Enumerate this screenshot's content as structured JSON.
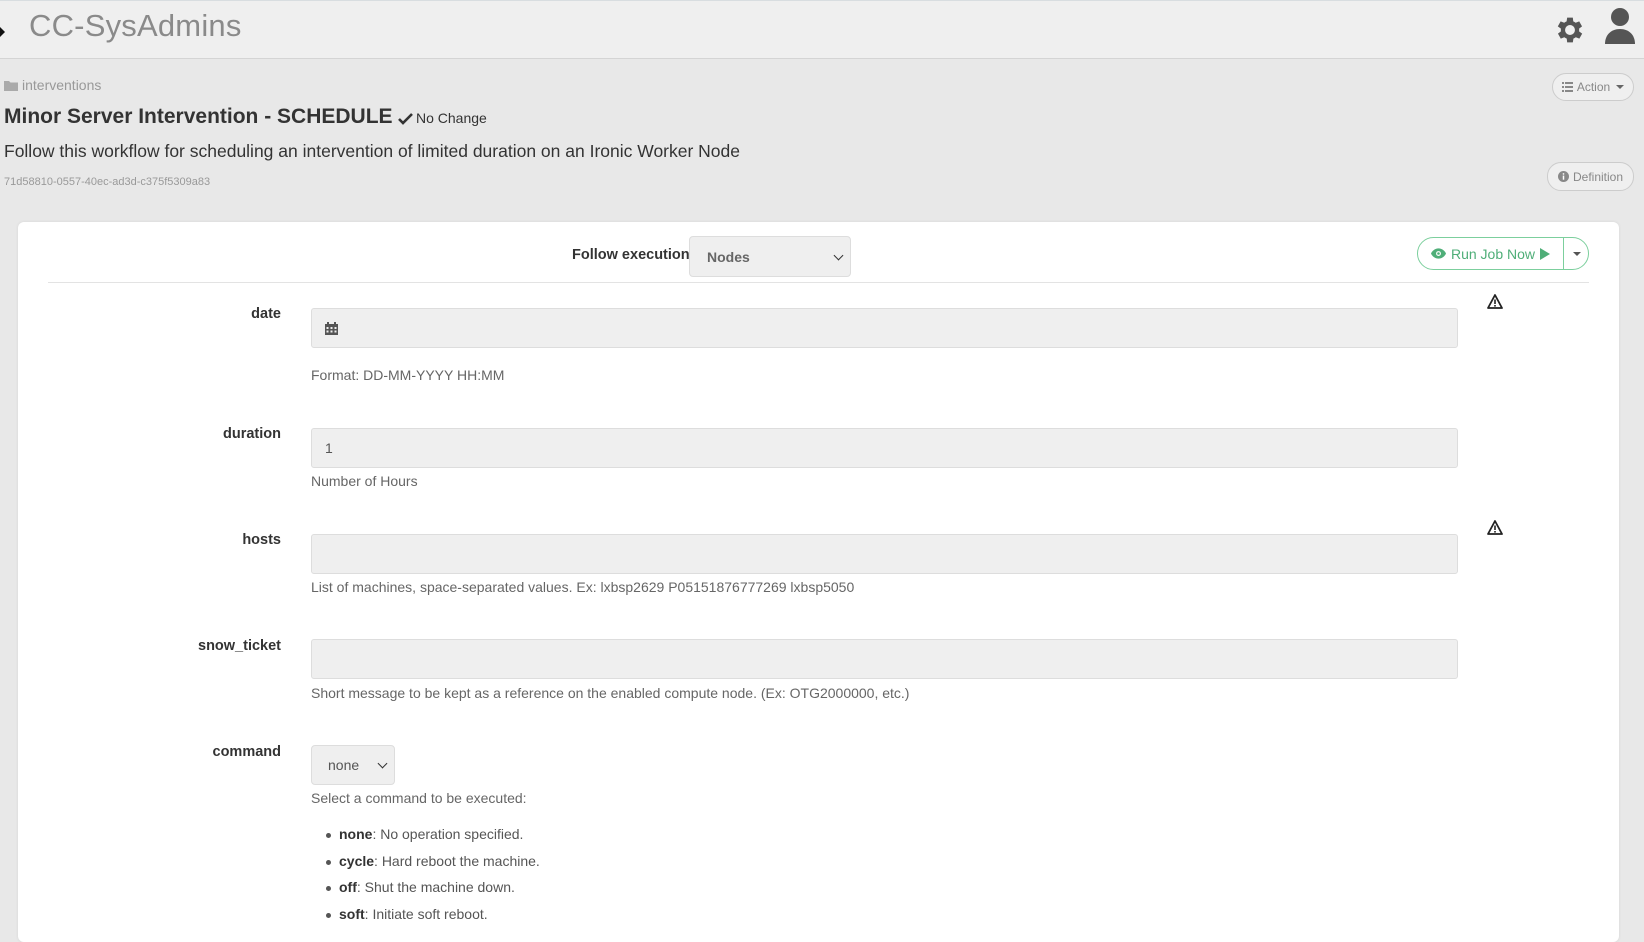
{
  "navbar": {
    "brand": "CC-SysAdmins"
  },
  "header": {
    "breadcrumb": "interventions",
    "title": "Minor Server Intervention - SCHEDULE",
    "status": "No Change",
    "description": "Follow this workflow for scheduling an intervention of limited duration on an Ironic Worker Node",
    "uuid": "71d58810-0557-40ec-ad3d-c375f5309a83",
    "action_label": "Action",
    "definition_label": "Definition"
  },
  "toolbar": {
    "follow_label": "Follow execution",
    "follow_value": "Nodes",
    "run_label": "Run Job Now"
  },
  "form": {
    "date": {
      "label": "date",
      "value": "",
      "help": "Format: DD-MM-YYYY HH:MM"
    },
    "duration": {
      "label": "duration",
      "value": "1",
      "help": "Number of Hours"
    },
    "hosts": {
      "label": "hosts",
      "value": "",
      "help": "List of machines, space-separated values. Ex: lxbsp2629 P05151876777269 lxbsp5050"
    },
    "snow_ticket": {
      "label": "snow_ticket",
      "value": "",
      "help": "Short message to be kept as a reference on the enabled compute node. (Ex: OTG2000000, etc.)"
    },
    "command": {
      "label": "command",
      "value": "none",
      "help": "Select a command to be executed:",
      "options": [
        {
          "name": "none",
          "desc": ": No operation specified."
        },
        {
          "name": "cycle",
          "desc": ": Hard reboot the machine."
        },
        {
          "name": "off",
          "desc": ": Shut the machine down."
        },
        {
          "name": "soft",
          "desc": ": Initiate soft reboot."
        }
      ]
    }
  },
  "colors": {
    "accent_green": "#4fae78",
    "background": "#e8e8e8"
  }
}
